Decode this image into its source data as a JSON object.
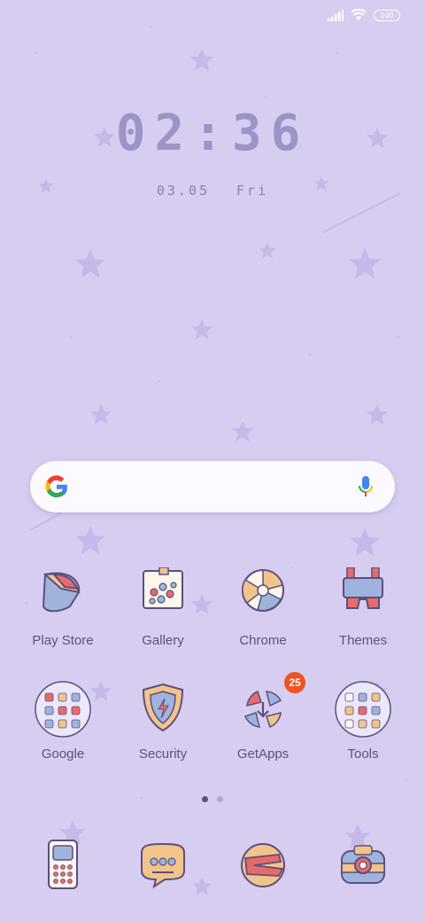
{
  "status_bar": {
    "battery": "100",
    "icons": [
      "signal-icon",
      "wifi-icon",
      "battery-icon"
    ]
  },
  "lockclock": {
    "time": "02:36",
    "date": "03.05",
    "weekday": "Fri"
  },
  "search": {
    "icons": [
      "google-g-icon",
      "microphone-icon"
    ]
  },
  "apps": [
    {
      "label": "Play Store",
      "icon": "play-store-icon"
    },
    {
      "label": "Gallery",
      "icon": "gallery-icon"
    },
    {
      "label": "Chrome",
      "icon": "chrome-icon"
    },
    {
      "label": "Themes",
      "icon": "themes-icon"
    },
    {
      "label": "Google",
      "icon": "google-folder-icon"
    },
    {
      "label": "Security",
      "icon": "security-icon"
    },
    {
      "label": "GetApps",
      "icon": "getapps-icon",
      "badge": "25"
    },
    {
      "label": "Tools",
      "icon": "tools-folder-icon"
    }
  ],
  "page_indicator": {
    "pages": 2,
    "current": 1
  },
  "dock": [
    {
      "icon": "phone-icon"
    },
    {
      "icon": "messages-icon"
    },
    {
      "icon": "browser-icon"
    },
    {
      "icon": "camera-icon"
    }
  ],
  "colors": {
    "background": "#d7cdf0",
    "text": "#5a537a",
    "clock": "#9c93c6",
    "badge": "#f05222"
  }
}
